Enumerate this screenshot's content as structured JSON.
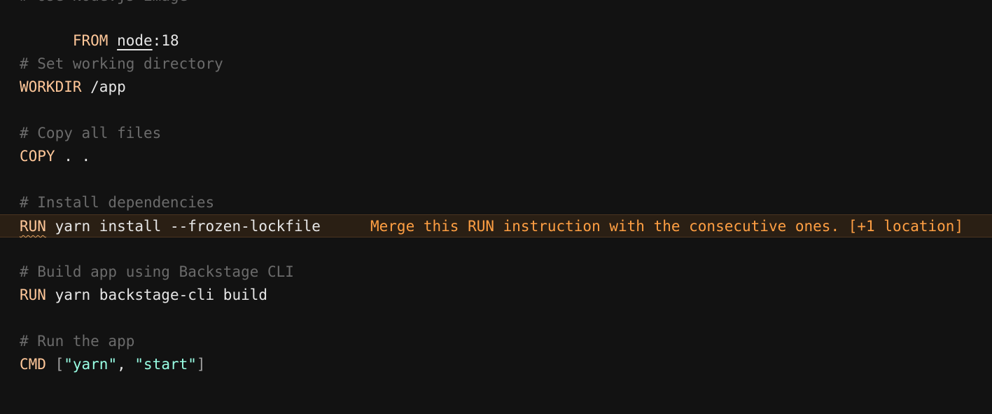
{
  "editor": {
    "partial_top_line": "# Use Node.js image",
    "lines": {
      "from": {
        "keyword": "FROM",
        "image": "node",
        "tag": ":18"
      },
      "comment_workdir": "# Set working directory",
      "workdir": {
        "keyword": "WORKDIR",
        "arg": " /app"
      },
      "comment_copy": "# Copy all files",
      "copy": {
        "keyword": "COPY",
        "arg": " . ."
      },
      "comment_install": "# Install dependencies",
      "run_install": {
        "keyword": "RUN",
        "arg": " yarn install --frozen-lockfile"
      },
      "comment_build": "# Build app using Backstage CLI",
      "run_build": {
        "keyword": "RUN",
        "arg": " yarn backstage-cli build"
      },
      "comment_run": "# Run the app",
      "cmd": {
        "keyword": "CMD",
        "open": " [",
        "str1": "\"yarn\"",
        "sep": ", ",
        "str2": "\"start\"",
        "close": "]"
      }
    },
    "diagnostic": {
      "message": "Merge this RUN instruction with the consecutive ones. [+1 location]",
      "color": "#ff9f43"
    }
  },
  "colors": {
    "background": "#121212",
    "keyword": "#ffc799",
    "comment": "#6b6b6b",
    "string": "#99ffe4",
    "text": "#e6e6e6",
    "highlight": "#2a1f14"
  }
}
